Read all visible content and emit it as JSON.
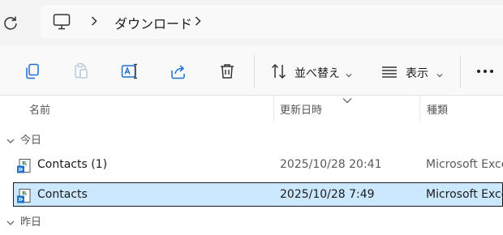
{
  "address_bar": {
    "refresh_icon": "refresh-icon",
    "pc_icon": "this-pc-icon",
    "breadcrumb": [
      "ダウンロード"
    ]
  },
  "toolbar": {
    "icons": [
      "copy-icon",
      "paste-icon",
      "rename-icon",
      "share-icon",
      "delete-icon"
    ],
    "sort_label": "並べ替え",
    "view_label": "表示",
    "more_icon": "more-icon"
  },
  "columns": {
    "name": "名前",
    "date": "更新日時",
    "type": "種類"
  },
  "groups": [
    {
      "label": "今日",
      "files": [
        {
          "name": "Contacts (1)",
          "date": "2025/10/28 20:41",
          "type": "Microsoft Excel",
          "selected": false
        },
        {
          "name": "Contacts",
          "date": "2025/10/28 7:49",
          "type": "Microsoft Excel",
          "selected": true
        }
      ]
    },
    {
      "label": "昨日",
      "files": []
    }
  ],
  "colors": {
    "selection_bg": "#cce8ff",
    "excel_green": "#1d6f42",
    "accent_blue": "#1d6fd1"
  }
}
